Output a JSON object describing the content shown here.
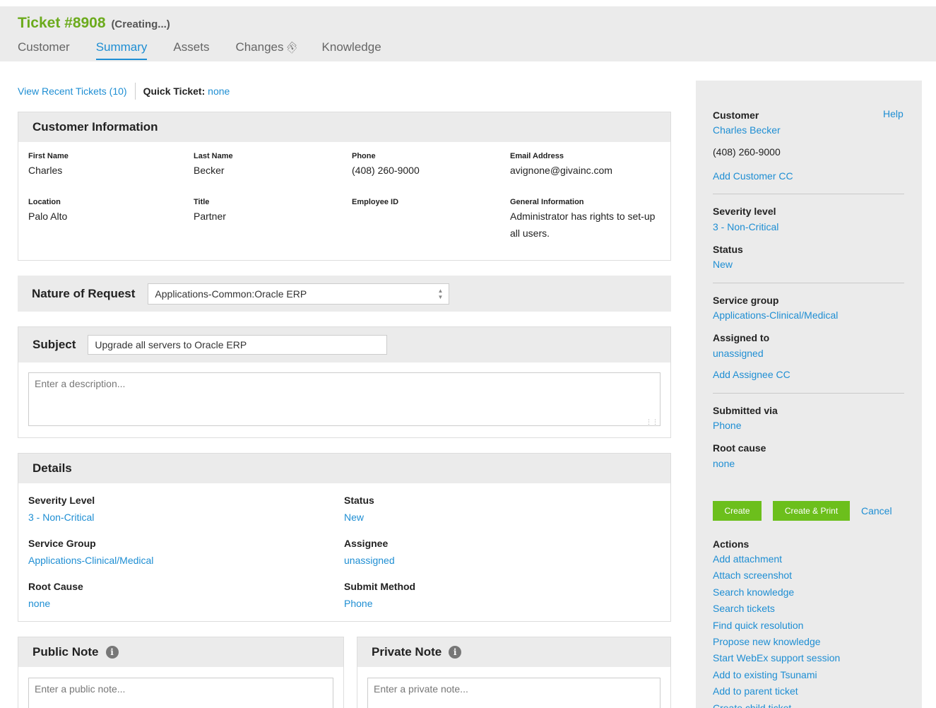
{
  "header": {
    "ticket_number": "Ticket #8908",
    "ticket_state": "(Creating...)",
    "tabs": [
      "Customer",
      "Summary",
      "Assets",
      "Changes",
      "Knowledge"
    ],
    "active_tab": "Summary"
  },
  "quickbar": {
    "recent_tickets": "View Recent Tickets (10)",
    "quick_ticket_label": "Quick Ticket:",
    "quick_ticket_value": "none"
  },
  "customer_info": {
    "title": "Customer Information",
    "fields": {
      "first_name": {
        "label": "First Name",
        "value": "Charles"
      },
      "last_name": {
        "label": "Last Name",
        "value": "Becker"
      },
      "phone": {
        "label": "Phone",
        "value": "(408) 260-9000"
      },
      "email": {
        "label": "Email Address",
        "value": "avignone@givainc.com"
      },
      "location": {
        "label": "Location",
        "value": "Palo Alto"
      },
      "title": {
        "label": "Title",
        "value": "Partner"
      },
      "employee_id": {
        "label": "Employee ID",
        "value": ""
      },
      "general_info": {
        "label": "General Information",
        "value": "Administrator has rights to set-up all users."
      }
    }
  },
  "nature": {
    "label": "Nature of Request",
    "value": "Applications-Common:Oracle ERP"
  },
  "subject": {
    "label": "Subject",
    "value": "Upgrade all servers to Oracle ERP",
    "description_placeholder": "Enter a description..."
  },
  "details": {
    "title": "Details",
    "severity": {
      "label": "Severity Level",
      "value": "3 - Non-Critical"
    },
    "status": {
      "label": "Status",
      "value": "New"
    },
    "service_group": {
      "label": "Service Group",
      "value": "Applications-Clinical/Medical"
    },
    "assignee": {
      "label": "Assignee",
      "value": "unassigned"
    },
    "root_cause": {
      "label": "Root Cause",
      "value": "none"
    },
    "submit_method": {
      "label": "Submit Method",
      "value": "Phone"
    }
  },
  "notes": {
    "public_title": "Public Note",
    "public_placeholder": "Enter a public note...",
    "private_title": "Private Note",
    "private_placeholder": "Enter a private note..."
  },
  "sidebar": {
    "customer_label": "Customer",
    "help": "Help",
    "customer_name": "Charles Becker",
    "customer_phone": "(408) 260-9000",
    "add_customer_cc": "Add Customer CC",
    "severity_label": "Severity level",
    "severity_value": "3 - Non-Critical",
    "status_label": "Status",
    "status_value": "New",
    "service_group_label": "Service group",
    "service_group_value": "Applications-Clinical/Medical",
    "assigned_label": "Assigned to",
    "assigned_value": "unassigned",
    "add_assignee_cc": "Add Assignee CC",
    "submitted_label": "Submitted via",
    "submitted_value": "Phone",
    "root_cause_label": "Root cause",
    "root_cause_value": "none",
    "create": "Create",
    "create_print": "Create & Print",
    "cancel": "Cancel",
    "actions_label": "Actions",
    "actions": [
      "Add attachment",
      "Attach screenshot",
      "Search knowledge",
      "Search tickets",
      "Find quick resolution",
      "Propose new knowledge",
      "Start WebEx support session",
      "Add to existing Tsunami",
      "Add to parent ticket",
      "Create child ticket"
    ]
  },
  "colors": {
    "accent_blue": "#1e8ed3",
    "brand_green": "#6cab1d",
    "button_green": "#6cbf1c",
    "panel_gray": "#ebebeb"
  }
}
